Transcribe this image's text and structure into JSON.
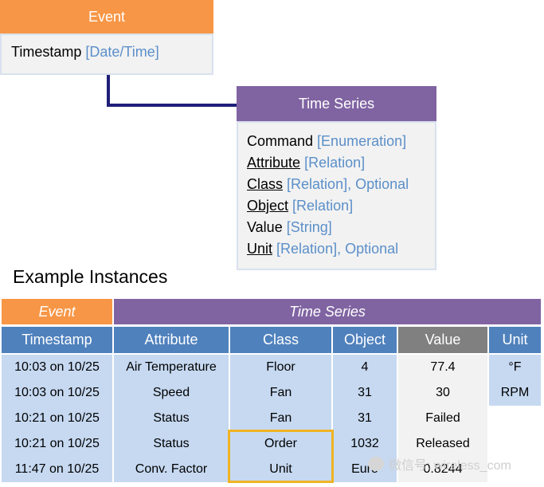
{
  "event_box": {
    "title": "Event",
    "fields": [
      {
        "name": "Timestamp",
        "type": "[Date/Time]",
        "underline": false
      }
    ]
  },
  "ts_box": {
    "title": "Time Series",
    "fields": [
      {
        "name": "Command",
        "type": "[Enumeration]",
        "underline": false
      },
      {
        "name": "Attribute",
        "type": "[Relation]",
        "underline": true
      },
      {
        "name": "Class",
        "type": "[Relation], Optional",
        "underline": true
      },
      {
        "name": "Object",
        "type": "[Relation]",
        "underline": true
      },
      {
        "name": "Value",
        "type": "[String]",
        "underline": false
      },
      {
        "name": "Unit",
        "type": "[Relation], Optional",
        "underline": true
      }
    ]
  },
  "examples_title": "Example Instances",
  "table": {
    "group_event": "Event",
    "group_ts": "Time Series",
    "headers": [
      "Timestamp",
      "Attribute",
      "Class",
      "Object",
      "Value",
      "Unit"
    ],
    "rows": [
      [
        "10:03 on 10/25",
        "Air Temperature",
        "Floor",
        "4",
        "77.4",
        "°F"
      ],
      [
        "10:03 on 10/25",
        "Speed",
        "Fan",
        "31",
        "30",
        "RPM"
      ],
      [
        "10:21 on 10/25",
        "Status",
        "Fan",
        "31",
        "Failed",
        ""
      ],
      [
        "10:21 on 10/25",
        "Status",
        "Order",
        "1032",
        "Released",
        ""
      ],
      [
        "11:47 on 10/25",
        "Conv. Factor",
        "Unit",
        "Euro",
        "0.8244",
        ""
      ]
    ]
  },
  "colors": {
    "event_orange": "#f79646",
    "ts_purple": "#8064a2",
    "header_blue": "#4f81bd",
    "value_gray": "#808080",
    "cell_blue": "#c6d9f1",
    "value_cell_gray": "#f2f2f2",
    "highlight": "#f0b323",
    "connector": "#1f1f7a"
  },
  "watermark": "微信号: wireless_com"
}
